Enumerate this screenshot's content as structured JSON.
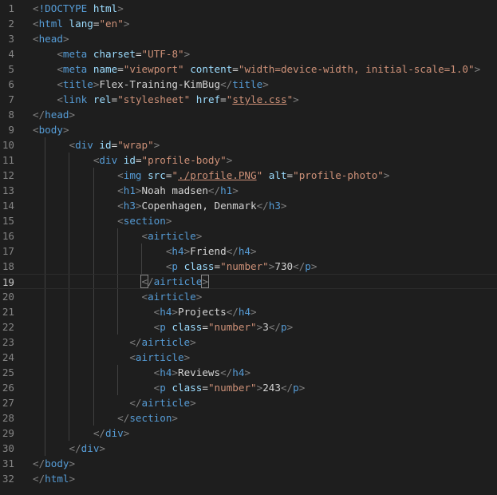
{
  "colors": {
    "background": "#1e1e1e",
    "line_number": "#858585",
    "tag": "#569cd6",
    "attribute": "#9cdcfe",
    "string": "#ce9178",
    "text": "#d4d4d4",
    "punctuation": "#808080"
  },
  "active_line": 19,
  "lines": [
    {
      "n": "1",
      "indent": 0,
      "tokens": [
        [
          "b",
          "<"
        ],
        [
          "t",
          "!DOCTYPE"
        ],
        [
          "x",
          " "
        ],
        [
          "a",
          "html"
        ],
        [
          "b",
          ">"
        ]
      ]
    },
    {
      "n": "2",
      "indent": 0,
      "tokens": [
        [
          "b",
          "<"
        ],
        [
          "t",
          "html"
        ],
        [
          "x",
          " "
        ],
        [
          "a",
          "lang"
        ],
        [
          "x",
          "="
        ],
        [
          "s",
          "\"en\""
        ],
        [
          "b",
          ">"
        ]
      ]
    },
    {
      "n": "3",
      "indent": 0,
      "tokens": [
        [
          "b",
          "<"
        ],
        [
          "t",
          "head"
        ],
        [
          "b",
          ">"
        ]
      ]
    },
    {
      "n": "4",
      "indent": 4,
      "tokens": [
        [
          "b",
          "<"
        ],
        [
          "t",
          "meta"
        ],
        [
          "x",
          " "
        ],
        [
          "a",
          "charset"
        ],
        [
          "x",
          "="
        ],
        [
          "s",
          "\"UTF-8\""
        ],
        [
          "b",
          ">"
        ]
      ]
    },
    {
      "n": "5",
      "indent": 4,
      "tokens": [
        [
          "b",
          "<"
        ],
        [
          "t",
          "meta"
        ],
        [
          "x",
          " "
        ],
        [
          "a",
          "name"
        ],
        [
          "x",
          "="
        ],
        [
          "s",
          "\"viewport\""
        ],
        [
          "x",
          " "
        ],
        [
          "a",
          "content"
        ],
        [
          "x",
          "="
        ],
        [
          "s",
          "\"width=device-width, initial-scale=1.0\""
        ],
        [
          "b",
          ">"
        ]
      ]
    },
    {
      "n": "6",
      "indent": 4,
      "tokens": [
        [
          "b",
          "<"
        ],
        [
          "t",
          "title"
        ],
        [
          "b",
          ">"
        ],
        [
          "x",
          "Flex-Training-KimBug"
        ],
        [
          "b",
          "</"
        ],
        [
          "t",
          "title"
        ],
        [
          "b",
          ">"
        ]
      ]
    },
    {
      "n": "7",
      "indent": 4,
      "tokens": [
        [
          "b",
          "<"
        ],
        [
          "t",
          "link"
        ],
        [
          "x",
          " "
        ],
        [
          "a",
          "rel"
        ],
        [
          "x",
          "="
        ],
        [
          "s",
          "\"stylesheet\""
        ],
        [
          "x",
          " "
        ],
        [
          "a",
          "href"
        ],
        [
          "x",
          "="
        ],
        [
          "s",
          "\""
        ],
        [
          "u",
          "style.css"
        ],
        [
          "s",
          "\""
        ],
        [
          "b",
          ">"
        ]
      ]
    },
    {
      "n": "8",
      "indent": 0,
      "tokens": [
        [
          "b",
          "</"
        ],
        [
          "t",
          "head"
        ],
        [
          "b",
          ">"
        ]
      ]
    },
    {
      "n": "9",
      "indent": 0,
      "tokens": [
        [
          "b",
          "<"
        ],
        [
          "t",
          "body"
        ],
        [
          "b",
          ">"
        ]
      ]
    },
    {
      "n": "10",
      "indent": 6,
      "tokens": [
        [
          "b",
          "<"
        ],
        [
          "t",
          "div"
        ],
        [
          "x",
          " "
        ],
        [
          "a",
          "id"
        ],
        [
          "x",
          "="
        ],
        [
          "s",
          "\"wrap\""
        ],
        [
          "b",
          ">"
        ]
      ]
    },
    {
      "n": "11",
      "indent": 10,
      "tokens": [
        [
          "b",
          "<"
        ],
        [
          "t",
          "div"
        ],
        [
          "x",
          " "
        ],
        [
          "a",
          "id"
        ],
        [
          "x",
          "="
        ],
        [
          "s",
          "\"profile-body\""
        ],
        [
          "b",
          ">"
        ]
      ]
    },
    {
      "n": "12",
      "indent": 14,
      "tokens": [
        [
          "b",
          "<"
        ],
        [
          "t",
          "img"
        ],
        [
          "x",
          " "
        ],
        [
          "a",
          "src"
        ],
        [
          "x",
          "="
        ],
        [
          "s",
          "\""
        ],
        [
          "u",
          "./profile.PNG"
        ],
        [
          "s",
          "\""
        ],
        [
          "x",
          " "
        ],
        [
          "a",
          "alt"
        ],
        [
          "x",
          "="
        ],
        [
          "s",
          "\"profile-photo\""
        ],
        [
          "b",
          ">"
        ]
      ]
    },
    {
      "n": "13",
      "indent": 14,
      "tokens": [
        [
          "b",
          "<"
        ],
        [
          "t",
          "h1"
        ],
        [
          "b",
          ">"
        ],
        [
          "x",
          "Noah madsen"
        ],
        [
          "b",
          "</"
        ],
        [
          "t",
          "h1"
        ],
        [
          "b",
          ">"
        ]
      ]
    },
    {
      "n": "14",
      "indent": 14,
      "tokens": [
        [
          "b",
          "<"
        ],
        [
          "t",
          "h3"
        ],
        [
          "b",
          ">"
        ],
        [
          "x",
          "Copenhagen, Denmark"
        ],
        [
          "b",
          "</"
        ],
        [
          "t",
          "h3"
        ],
        [
          "b",
          ">"
        ]
      ]
    },
    {
      "n": "15",
      "indent": 14,
      "tokens": [
        [
          "b",
          "<"
        ],
        [
          "t",
          "section"
        ],
        [
          "b",
          ">"
        ]
      ]
    },
    {
      "n": "16",
      "indent": 18,
      "tokens": [
        [
          "b",
          "<"
        ],
        [
          "t",
          "airticle"
        ],
        [
          "b",
          ">"
        ]
      ]
    },
    {
      "n": "17",
      "indent": 22,
      "tokens": [
        [
          "b",
          "<"
        ],
        [
          "t",
          "h4"
        ],
        [
          "b",
          ">"
        ],
        [
          "x",
          "Friend"
        ],
        [
          "b",
          "</"
        ],
        [
          "t",
          "h4"
        ],
        [
          "b",
          ">"
        ]
      ]
    },
    {
      "n": "18",
      "indent": 22,
      "tokens": [
        [
          "b",
          "<"
        ],
        [
          "t",
          "p"
        ],
        [
          "x",
          " "
        ],
        [
          "a",
          "class"
        ],
        [
          "x",
          "="
        ],
        [
          "s",
          "\"number\""
        ],
        [
          "b",
          ">"
        ],
        [
          "x",
          "730"
        ],
        [
          "b",
          "</"
        ],
        [
          "t",
          "p"
        ],
        [
          "b",
          ">"
        ]
      ]
    },
    {
      "n": "19",
      "indent": 18,
      "tokens": [
        [
          "m",
          "<"
        ],
        [
          "b",
          "/"
        ],
        [
          "t",
          "airticle"
        ],
        [
          "m",
          ">"
        ]
      ]
    },
    {
      "n": "20",
      "indent": 18,
      "tokens": [
        [
          "b",
          "<"
        ],
        [
          "t",
          "airticle"
        ],
        [
          "b",
          ">"
        ]
      ]
    },
    {
      "n": "21",
      "indent": 20,
      "tokens": [
        [
          "b",
          "<"
        ],
        [
          "t",
          "h4"
        ],
        [
          "b",
          ">"
        ],
        [
          "x",
          "Projects"
        ],
        [
          "b",
          "</"
        ],
        [
          "t",
          "h4"
        ],
        [
          "b",
          ">"
        ]
      ]
    },
    {
      "n": "22",
      "indent": 20,
      "tokens": [
        [
          "b",
          "<"
        ],
        [
          "t",
          "p"
        ],
        [
          "x",
          " "
        ],
        [
          "a",
          "class"
        ],
        [
          "x",
          "="
        ],
        [
          "s",
          "\"number\""
        ],
        [
          "b",
          ">"
        ],
        [
          "x",
          "3"
        ],
        [
          "b",
          "</"
        ],
        [
          "t",
          "p"
        ],
        [
          "b",
          ">"
        ]
      ]
    },
    {
      "n": "23",
      "indent": 16,
      "tokens": [
        [
          "b",
          "</"
        ],
        [
          "t",
          "airticle"
        ],
        [
          "b",
          ">"
        ]
      ]
    },
    {
      "n": "24",
      "indent": 16,
      "tokens": [
        [
          "b",
          "<"
        ],
        [
          "t",
          "airticle"
        ],
        [
          "b",
          ">"
        ]
      ]
    },
    {
      "n": "25",
      "indent": 20,
      "tokens": [
        [
          "b",
          "<"
        ],
        [
          "t",
          "h4"
        ],
        [
          "b",
          ">"
        ],
        [
          "x",
          "Reviews"
        ],
        [
          "b",
          "</"
        ],
        [
          "t",
          "h4"
        ],
        [
          "b",
          ">"
        ]
      ]
    },
    {
      "n": "26",
      "indent": 20,
      "tokens": [
        [
          "b",
          "<"
        ],
        [
          "t",
          "p"
        ],
        [
          "x",
          " "
        ],
        [
          "a",
          "class"
        ],
        [
          "x",
          "="
        ],
        [
          "s",
          "\"number\""
        ],
        [
          "b",
          ">"
        ],
        [
          "x",
          "243"
        ],
        [
          "b",
          "</"
        ],
        [
          "t",
          "p"
        ],
        [
          "b",
          ">"
        ]
      ]
    },
    {
      "n": "27",
      "indent": 16,
      "tokens": [
        [
          "b",
          "</"
        ],
        [
          "t",
          "airticle"
        ],
        [
          "b",
          ">"
        ]
      ]
    },
    {
      "n": "28",
      "indent": 14,
      "tokens": [
        [
          "b",
          "</"
        ],
        [
          "t",
          "section"
        ],
        [
          "b",
          ">"
        ]
      ]
    },
    {
      "n": "29",
      "indent": 10,
      "tokens": [
        [
          "b",
          "</"
        ],
        [
          "t",
          "div"
        ],
        [
          "b",
          ">"
        ]
      ]
    },
    {
      "n": "30",
      "indent": 6,
      "tokens": [
        [
          "b",
          "</"
        ],
        [
          "t",
          "div"
        ],
        [
          "b",
          ">"
        ]
      ]
    },
    {
      "n": "31",
      "indent": 0,
      "tokens": [
        [
          "b",
          "</"
        ],
        [
          "t",
          "body"
        ],
        [
          "b",
          ">"
        ]
      ]
    },
    {
      "n": "32",
      "indent": 0,
      "tokens": [
        [
          "b",
          "</"
        ],
        [
          "t",
          "html"
        ],
        [
          "b",
          ">"
        ]
      ]
    }
  ]
}
